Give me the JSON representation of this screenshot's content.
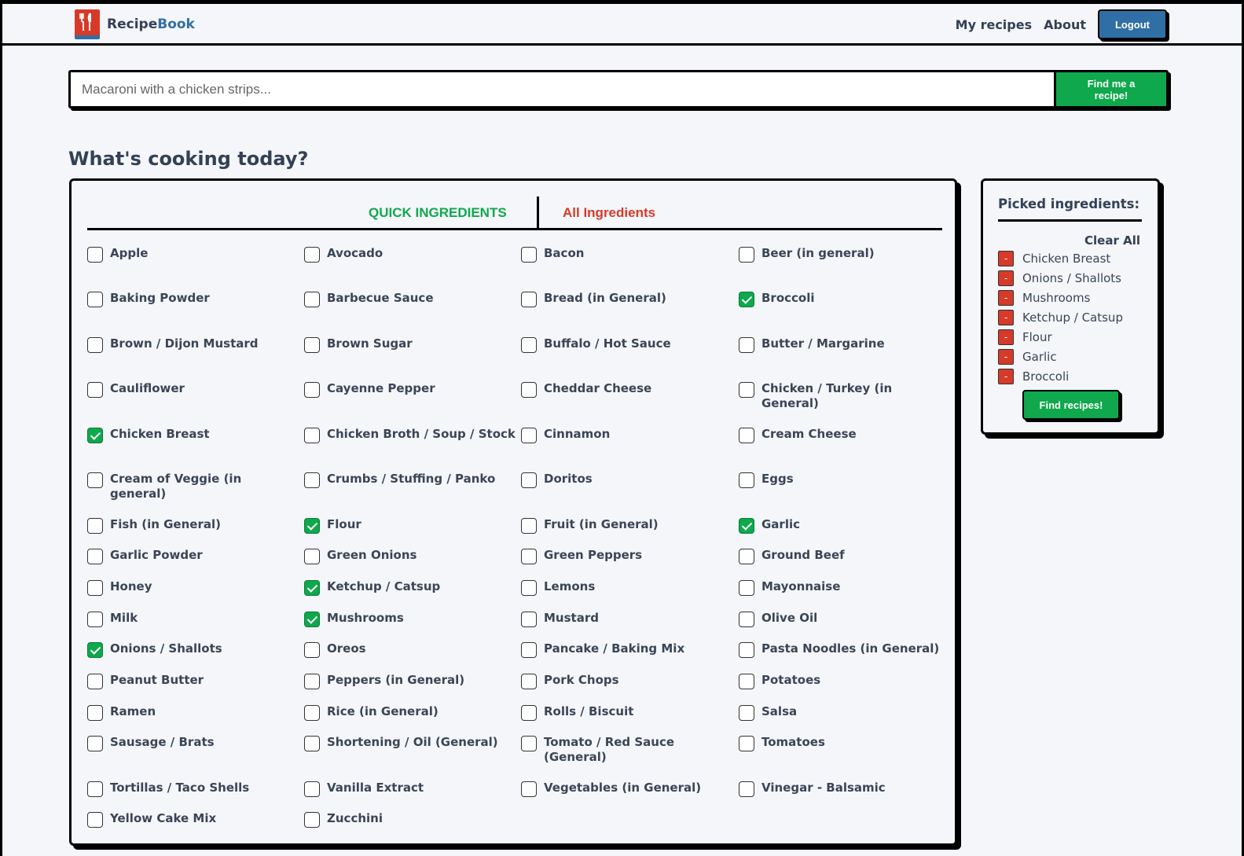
{
  "header": {
    "brand_part1": "Recipe",
    "brand_part2": "Book",
    "nav": [
      "My recipes",
      "About"
    ],
    "logout_label": "Logout"
  },
  "search": {
    "placeholder": "Macaroni with a chicken strips...",
    "button_label": "Find me a recipe!"
  },
  "heading": "What's cooking today?",
  "tabs": {
    "quick": "QUICK INGREDIENTS",
    "all": "All Ingredients"
  },
  "ingredients": [
    {
      "label": "Apple",
      "checked": false
    },
    {
      "label": "Avocado",
      "checked": false
    },
    {
      "label": "Bacon",
      "checked": false
    },
    {
      "label": "Beer (in general)",
      "checked": false
    },
    {
      "label": "Baking Powder",
      "checked": false
    },
    {
      "label": "Barbecue Sauce",
      "checked": false
    },
    {
      "label": "Bread (in General)",
      "checked": false
    },
    {
      "label": "Broccoli",
      "checked": true
    },
    {
      "label": "Brown / Dijon Mustard",
      "checked": false
    },
    {
      "label": "Brown Sugar",
      "checked": false
    },
    {
      "label": "Buffalo / Hot Sauce",
      "checked": false
    },
    {
      "label": "Butter / Margarine",
      "checked": false
    },
    {
      "label": "Cauliflower",
      "checked": false
    },
    {
      "label": "Cayenne Pepper",
      "checked": false
    },
    {
      "label": "Cheddar Cheese",
      "checked": false
    },
    {
      "label": "Chicken / Turkey (in General)",
      "checked": false
    },
    {
      "label": "Chicken Breast",
      "checked": true
    },
    {
      "label": "Chicken Broth / Soup / Stock",
      "checked": false
    },
    {
      "label": "Cinnamon",
      "checked": false
    },
    {
      "label": "Cream Cheese",
      "checked": false
    },
    {
      "label": "Cream of Veggie (in general)",
      "checked": false
    },
    {
      "label": "Crumbs / Stuffing / Panko",
      "checked": false
    },
    {
      "label": "Doritos",
      "checked": false
    },
    {
      "label": "Eggs",
      "checked": false
    },
    {
      "label": "Fish (in General)",
      "checked": false
    },
    {
      "label": "Flour",
      "checked": true
    },
    {
      "label": "Fruit (in General)",
      "checked": false
    },
    {
      "label": "Garlic",
      "checked": true
    },
    {
      "label": "Garlic Powder",
      "checked": false
    },
    {
      "label": "Green Onions",
      "checked": false
    },
    {
      "label": "Green Peppers",
      "checked": false
    },
    {
      "label": "Ground Beef",
      "checked": false
    },
    {
      "label": "Honey",
      "checked": false
    },
    {
      "label": "Ketchup / Catsup",
      "checked": true
    },
    {
      "label": "Lemons",
      "checked": false
    },
    {
      "label": "Mayonnaise",
      "checked": false
    },
    {
      "label": "Milk",
      "checked": false
    },
    {
      "label": "Mushrooms",
      "checked": true
    },
    {
      "label": "Mustard",
      "checked": false
    },
    {
      "label": "Olive Oil",
      "checked": false
    },
    {
      "label": "Onions / Shallots",
      "checked": true
    },
    {
      "label": "Oreos",
      "checked": false
    },
    {
      "label": "Pancake / Baking Mix",
      "checked": false
    },
    {
      "label": "Pasta Noodles (in General)",
      "checked": false
    },
    {
      "label": "Peanut Butter",
      "checked": false
    },
    {
      "label": "Peppers (in General)",
      "checked": false
    },
    {
      "label": "Pork Chops",
      "checked": false
    },
    {
      "label": "Potatoes",
      "checked": false
    },
    {
      "label": "Ramen",
      "checked": false
    },
    {
      "label": "Rice (in General)",
      "checked": false
    },
    {
      "label": "Rolls / Biscuit",
      "checked": false
    },
    {
      "label": "Salsa",
      "checked": false
    },
    {
      "label": "Sausage / Brats",
      "checked": false
    },
    {
      "label": "Shortening / Oil (General)",
      "checked": false
    },
    {
      "label": "Tomato / Red Sauce (General)",
      "checked": false
    },
    {
      "label": "Tomatoes",
      "checked": false
    },
    {
      "label": "Tortillas / Taco Shells",
      "checked": false
    },
    {
      "label": "Vanilla Extract",
      "checked": false
    },
    {
      "label": "Vegetables (in General)",
      "checked": false
    },
    {
      "label": "Vinegar - Balsamic",
      "checked": false
    },
    {
      "label": "Yellow Cake Mix",
      "checked": false
    },
    {
      "label": "Zucchini",
      "checked": false
    }
  ],
  "picked": {
    "title": "Picked ingredients:",
    "clear_all": "Clear All",
    "remove_symbol": "-",
    "items": [
      "Chicken Breast",
      "Onions / Shallots",
      "Mushrooms",
      "Ketchup / Catsup",
      "Flour",
      "Garlic",
      "Broccoli"
    ],
    "find_button": "Find recipes!"
  },
  "colors": {
    "accent_green": "#0fa84c",
    "accent_blue": "#2f6fa5",
    "accent_red": "#d63a28"
  }
}
